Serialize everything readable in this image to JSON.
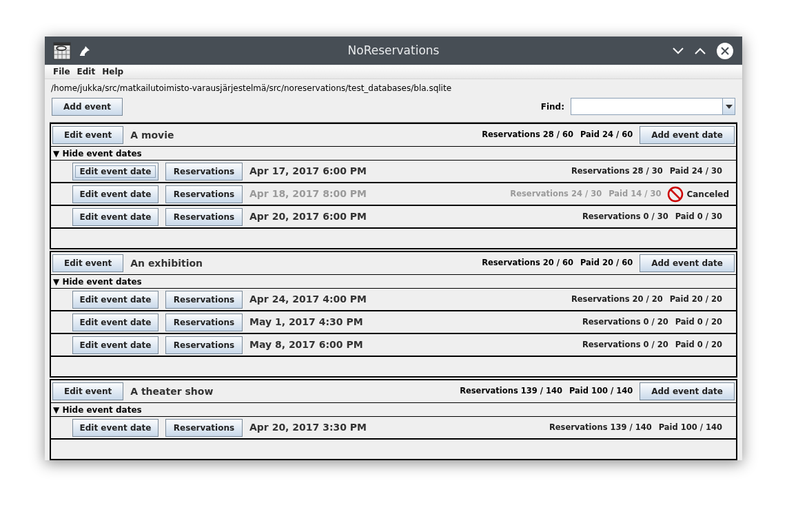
{
  "window": {
    "title": "NoReservations"
  },
  "menu": [
    "File",
    "Edit",
    "Help"
  ],
  "path": "/home/jukka/src/matkailutoimisto-varausjärjestelmä/src/noreservations/test_databases/bla.sqlite",
  "add_event_button": "Add event",
  "find": {
    "label": "Find:"
  },
  "events": [
    {
      "edit_button": "Edit event",
      "name": "A movie",
      "reservations": "Reservations 28 / 60",
      "paid": "Paid 24 / 60",
      "add_date_button": "Add event date",
      "toggle": "▼ Hide event dates",
      "dates": [
        {
          "edit_button": "Edit event date",
          "reservations_button": "Reservations",
          "date": "Apr 17, 2017 6:00 PM",
          "reservations": "Reservations 28 / 30",
          "paid": "Paid 24 / 30",
          "focused": true,
          "canceled": false
        },
        {
          "edit_button": "Edit event date",
          "reservations_button": "Reservations",
          "date": "Apr 18, 2017 8:00 PM",
          "reservations": "Reservations 24 / 30",
          "paid": "Paid 14 / 30",
          "focused": false,
          "canceled": true,
          "status": "Canceled"
        },
        {
          "edit_button": "Edit event date",
          "reservations_button": "Reservations",
          "date": "Apr 20, 2017 6:00 PM",
          "reservations": "Reservations 0 / 30",
          "paid": "Paid 0 / 30",
          "focused": false,
          "canceled": false
        }
      ]
    },
    {
      "edit_button": "Edit event",
      "name": "An exhibition",
      "reservations": "Reservations 20 / 60",
      "paid": "Paid 20 / 60",
      "add_date_button": "Add event date",
      "toggle": "▼ Hide event dates",
      "dates": [
        {
          "edit_button": "Edit event date",
          "reservations_button": "Reservations",
          "date": "Apr 24, 2017 4:00 PM",
          "reservations": "Reservations 20 / 20",
          "paid": "Paid 20 / 20",
          "focused": false,
          "canceled": false
        },
        {
          "edit_button": "Edit event date",
          "reservations_button": "Reservations",
          "date": "May 1, 2017 4:30 PM",
          "reservations": "Reservations 0 / 20",
          "paid": "Paid 0 / 20",
          "focused": false,
          "canceled": false
        },
        {
          "edit_button": "Edit event date",
          "reservations_button": "Reservations",
          "date": "May 8, 2017 6:00 PM",
          "reservations": "Reservations 0 / 20",
          "paid": "Paid 0 / 20",
          "focused": false,
          "canceled": false
        }
      ]
    },
    {
      "edit_button": "Edit event",
      "name": "A theater show",
      "reservations": "Reservations 139 / 140",
      "paid": "Paid 100 / 140",
      "add_date_button": "Add event date",
      "toggle": "▼ Hide event dates",
      "dates": [
        {
          "edit_button": "Edit event date",
          "reservations_button": "Reservations",
          "date": "Apr 20, 2017 3:30 PM",
          "reservations": "Reservations 139 / 140",
          "paid": "Paid 100 / 140",
          "focused": false,
          "canceled": false
        }
      ]
    }
  ]
}
